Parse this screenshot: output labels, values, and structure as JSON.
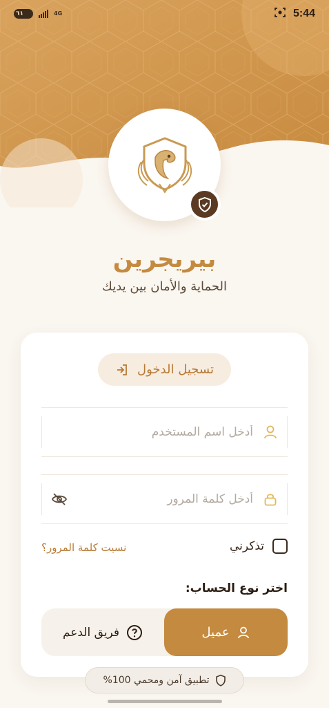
{
  "status_bar": {
    "battery": "٦١",
    "network": "4G",
    "time": "5:44"
  },
  "brand": {
    "name": "بيريجرين",
    "tagline": "الحماية والأمان بين يديك",
    "accent_color": "#c48a3f",
    "dark_color": "#5a3a22"
  },
  "login": {
    "tab_label": "تسجيل الدخول",
    "username_placeholder": "أدخل اسم المستخدم",
    "password_placeholder": "أدخل كلمة المرور",
    "remember_label": "تذكرني",
    "forgot_label": "نسيت كلمة المرور؟"
  },
  "account_type": {
    "label": "اختر نوع الحساب:",
    "options": [
      {
        "label": "عميل",
        "icon": "user-icon",
        "selected": true
      },
      {
        "label": "فريق الدعم",
        "icon": "help-circle-icon",
        "selected": false
      }
    ]
  },
  "footer": {
    "secure_label": "تطبيق آمن ومحمي 100%"
  }
}
